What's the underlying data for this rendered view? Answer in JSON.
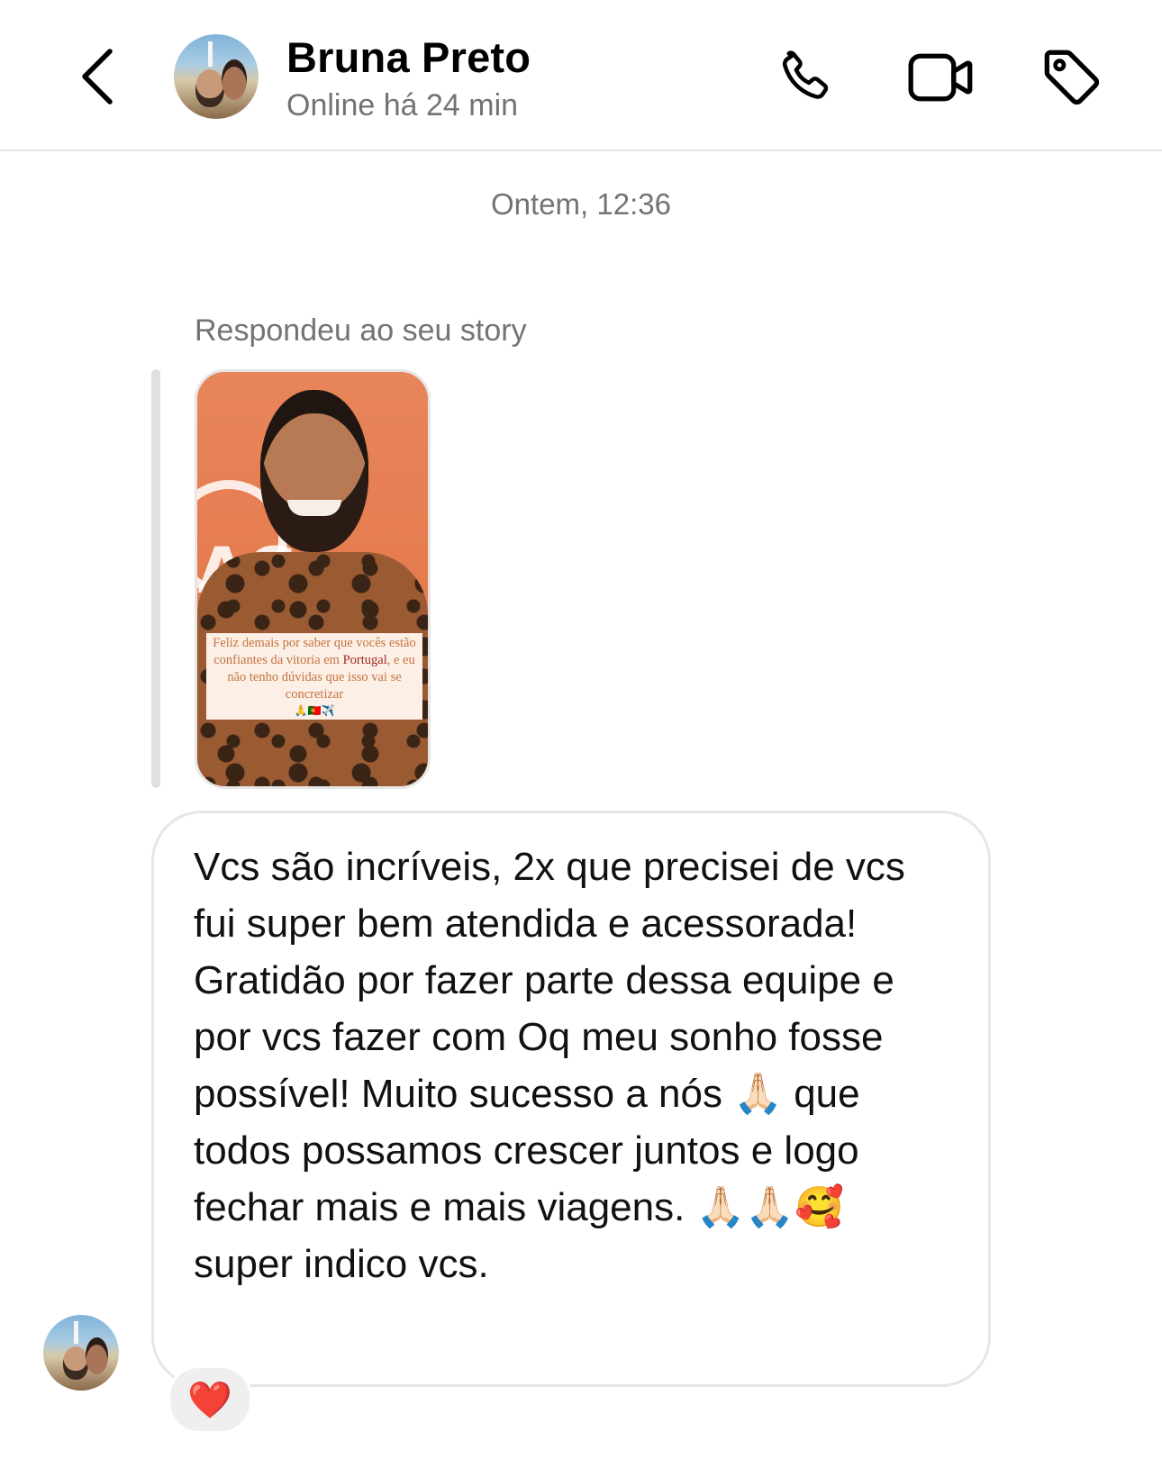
{
  "header": {
    "contact_name": "Bruna Preto",
    "status": "Online há 24 min",
    "back_icon": "chevron-left-icon",
    "actions": [
      {
        "name": "phone-icon"
      },
      {
        "name": "video-icon"
      },
      {
        "name": "tag-icon"
      }
    ]
  },
  "conversation": {
    "timestamp": "Ontem, 12:36",
    "story_reply": {
      "label": "Respondeu ao seu story",
      "caption_line1": "Feliz demais por saber que vocês estão confiantes da vitoria em",
      "caption_highlight": "Portugal",
      "caption_line2": ", e eu não tenho dúvidas que isso vai se concretizar",
      "caption_emojis": "🙏🇵🇹✈️"
    },
    "message": {
      "text": "Vcs são incríveis, 2x que precisei de vcs fui super bem atendida e acessorada!\nGratidão por fazer parte dessa equipe e por vcs fazer com Oq meu sonho fosse possível! Muito sucesso a nós 🙏🏻 que todos possamos crescer juntos e logo fechar mais e mais viagens. 🙏🏻🙏🏻🥰 super indico vcs.",
      "reaction": "❤️"
    }
  },
  "colors": {
    "secondary_text": "#737373",
    "border": "#e6e6e6",
    "reaction_bg": "#efefef"
  }
}
